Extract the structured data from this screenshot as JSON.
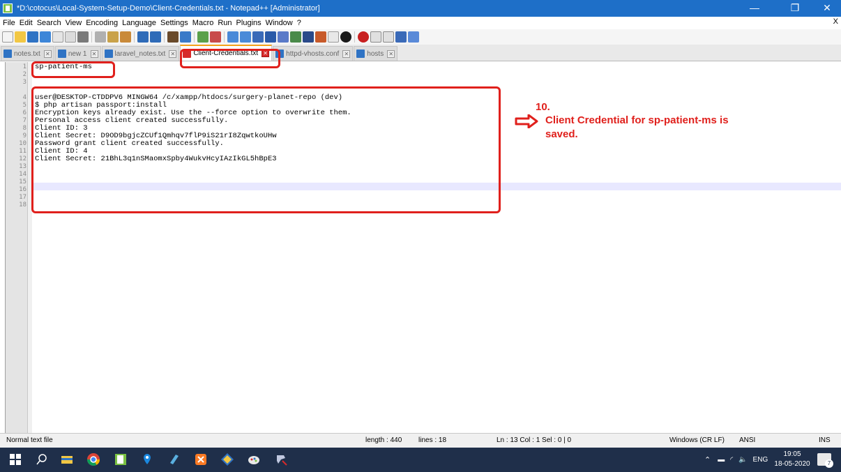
{
  "window": {
    "title": "*D:\\cotocus\\Local-System-Setup-Demo\\Client-Credentials.txt - Notepad++ [Administrator]",
    "minimize": "—",
    "maximize": "❐",
    "close": "✕"
  },
  "menu": {
    "items": [
      "File",
      "Edit",
      "Search",
      "View",
      "Encoding",
      "Language",
      "Settings",
      "Macro",
      "Run",
      "Plugins",
      "Window",
      "?"
    ],
    "close_label": "X"
  },
  "tabs": [
    {
      "label": "notes.txt",
      "state": "saved"
    },
    {
      "label": "new 1",
      "state": "saved"
    },
    {
      "label": "laravel_notes.txt",
      "state": "saved"
    },
    {
      "label": "Client-Credentials.txt",
      "state": "modified",
      "active": true
    },
    {
      "label": "httpd-vhosts.conf",
      "state": "saved"
    },
    {
      "label": "hosts",
      "state": "saved"
    }
  ],
  "editor": {
    "line_numbers": [
      "1",
      "2",
      "3",
      "4",
      "5",
      "6",
      "7",
      "8",
      "9",
      "10",
      "11",
      "12",
      "13",
      "14",
      "15",
      "16",
      "17",
      "18"
    ],
    "lines": [
      "sp-patient-ms",
      "",
      "",
      "user@DESKTOP-CTDDPV6 MINGW64 /c/xampp/htdocs/surgery-planet-repo (dev)",
      "$ php artisan passport:install",
      "Encryption keys already exist. Use the --force option to overwrite them.",
      "Personal access client created successfully.",
      "Client ID: 3",
      "Client Secret: D9OD9bgjcZCUf1Qmhqv7flP9iS21rI8ZqwtkoUHw",
      "Password grant client created successfully.",
      "Client ID: 4",
      "Client Secret: 21BhL3q1nSMaomxSpby4WukvHcyIAzIkGL5hBpE3",
      "",
      "",
      "",
      "",
      "",
      ""
    ]
  },
  "annotation": {
    "number": "10.",
    "line1": "Client Credential for sp-patient-ms is",
    "line2": "saved.",
    "color": "#e0201c"
  },
  "statusbar": {
    "file_type": "Normal text file",
    "length": "length : 440",
    "lines": "lines : 18",
    "position": "Ln : 13   Col : 1   Sel : 0 | 0",
    "eol": "Windows (CR LF)",
    "encoding": "ANSI",
    "mode": "INS"
  },
  "taskbar": {
    "icons": [
      "windows-start-icon",
      "search-icon",
      "file-explorer-icon",
      "chrome-icon",
      "notepad-plus-plus-icon",
      "maps-icon",
      "app-icon",
      "xampp-icon",
      "git-icon",
      "paint-icon",
      "tool-icon"
    ],
    "tray_lang": "ENG",
    "time": "19:05",
    "date": "18-05-2020",
    "notification_count": "7"
  }
}
